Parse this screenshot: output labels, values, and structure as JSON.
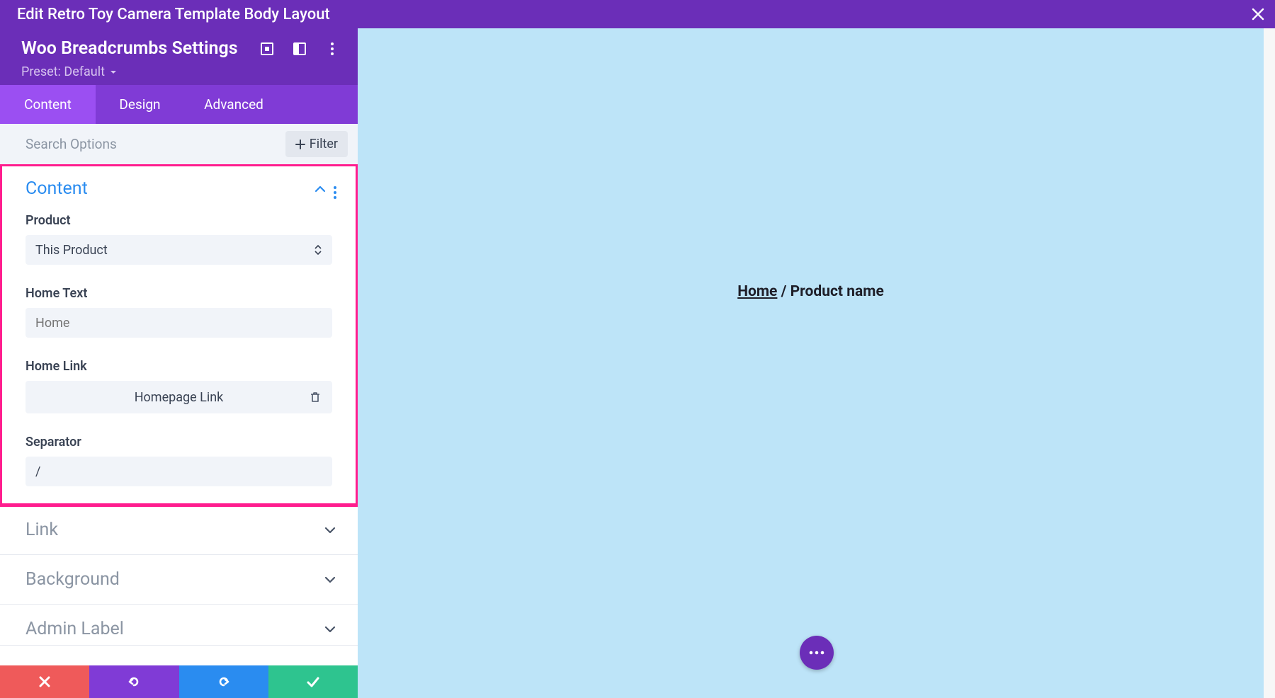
{
  "topbar": {
    "title": "Edit Retro Toy Camera Template Body Layout"
  },
  "panel": {
    "module_title": "Woo Breadcrumbs Settings",
    "preset_label": "Preset: Default",
    "tabs": {
      "content": "Content",
      "design": "Design",
      "advanced": "Advanced"
    },
    "search": {
      "placeholder": "Search Options",
      "filter_label": "Filter"
    },
    "sections": {
      "content": {
        "title": "Content",
        "fields": {
          "product_label": "Product",
          "product_value": "This Product",
          "home_text_label": "Home Text",
          "home_text_placeholder": "Home",
          "home_link_label": "Home Link",
          "home_link_value": "Homepage Link",
          "separator_label": "Separator",
          "separator_value": "/"
        }
      },
      "link": {
        "title": "Link"
      },
      "background": {
        "title": "Background"
      },
      "admin_label": {
        "title": "Admin Label"
      }
    }
  },
  "preview": {
    "breadcrumb_home": "Home",
    "breadcrumb_sep": " / ",
    "breadcrumb_current": "Product name"
  }
}
